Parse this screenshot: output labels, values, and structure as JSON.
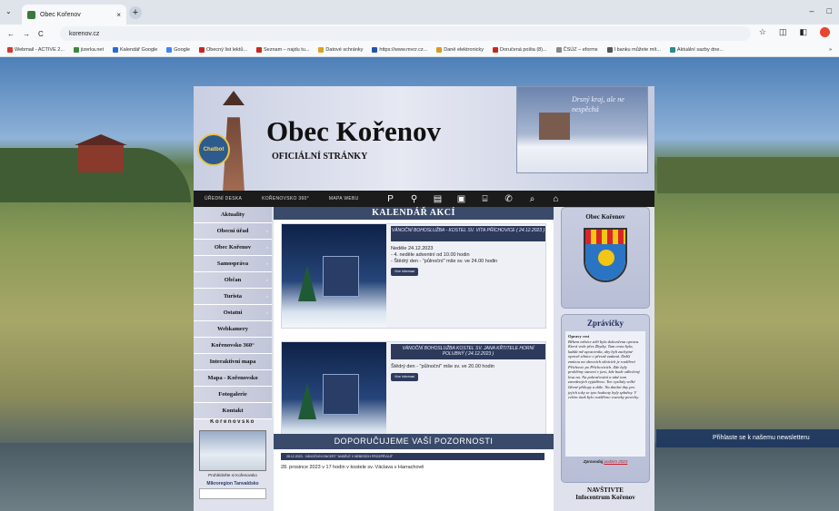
{
  "browser": {
    "tab_title": "Obec Kořenov",
    "tab_close": "×",
    "new_tab": "+",
    "tab_menu": "⌄",
    "url": "korenov.cz",
    "win_min": "–",
    "win_max": "□",
    "nav_back": "←",
    "nav_fwd": "→",
    "nav_reload": "C",
    "bookmarks": [
      {
        "label": "Webmail - ACTIVE 2...",
        "color": "#d23a2a"
      },
      {
        "label": "jizerka.net",
        "color": "#3a8a3a"
      },
      {
        "label": "Kalendář Google",
        "color": "#2a6ad8"
      },
      {
        "label": "Google",
        "color": "#4285f4"
      },
      {
        "label": "Obecný list lektů...",
        "color": "#c8281e"
      },
      {
        "label": "Seznam – najdu tu...",
        "color": "#c8281e"
      },
      {
        "label": "Datové schránky",
        "color": "#e0a020"
      },
      {
        "label": "https://www.mvcr.cz...",
        "color": "#2255aa"
      },
      {
        "label": "Daně elektronicky",
        "color": "#d89a20"
      },
      {
        "label": "Doručená pošta (8)...",
        "color": "#c8281e"
      },
      {
        "label": "ČSÚZ – eforms",
        "color": "#888888"
      },
      {
        "label": "I banku můžete mít...",
        "color": "#555555"
      },
      {
        "label": "Aktuální sazby dne...",
        "color": "#2a8a8a"
      }
    ],
    "bookmarks_more": "»"
  },
  "header": {
    "title": "Obec Kořenov",
    "subtitle": "OFICIÁLNÍ STRÁNKY",
    "chatbot": "Chatbot",
    "motto": "Drsný kraj, ale ne nespěchá"
  },
  "nav": {
    "items": [
      "ÚŘEDNÍ DESKA",
      "KOŘENOVSKO 360°",
      "MAPA WEBU"
    ],
    "icons": [
      "P",
      "⚲",
      "▤",
      "▣",
      "⌸",
      "✆",
      "⌕",
      "⌂"
    ]
  },
  "left_menu": {
    "items": [
      {
        "label": "Aktuality",
        "arrow": ""
      },
      {
        "label": "Obecní úřad",
        "arrow": "›"
      },
      {
        "label": "Obec Kořenov",
        "arrow": "›"
      },
      {
        "label": "Samospráva",
        "arrow": "›"
      },
      {
        "label": "Občan",
        "arrow": "›"
      },
      {
        "label": "Turista",
        "arrow": "›"
      },
      {
        "label": "Ostatní",
        "arrow": "›"
      },
      {
        "label": "Webkamery",
        "arrow": ""
      },
      {
        "label": "Kořenovsko 360°",
        "arrow": ""
      },
      {
        "label": "Interaktivní mapa",
        "arrow": ""
      },
      {
        "label": "Mapa - Kořenovsko",
        "arrow": ""
      },
      {
        "label": "Fotogalerie",
        "arrow": ""
      },
      {
        "label": "Kontakt",
        "arrow": ""
      }
    ],
    "webcam_head": "Kořenovsko",
    "webcam_caption": "Prohlédněte si Kořenovsko",
    "mikroregion": "Mikroregion Tanvaldsko"
  },
  "calendar": {
    "title": "KALENDÁŘ AKCÍ",
    "events": [
      {
        "heading": "VÁNOČNÍ BOHOSLUŽBA - KOSTEL SV. VÍTA PŘÍCHOVICE ( 24.12.2023 )",
        "lines": [
          "Neděle 24.12.2023",
          "- 4. neděle adventní od 10.00 hodin",
          "- Štědrý den - \"půlnoční\" mše sv. ve 24.00 hodin"
        ],
        "button": "Více informací"
      },
      {
        "heading": "VÁNOČNÍ BOHOSLUŽBA KOSTEL SV. JANA KŘTITELE HORNÍ POLUBNÝ ( 24.12.2023 )",
        "lines": [
          "Štědrý den - \"půlnoční\" mše sv. ve 20.00 hodin"
        ],
        "button": "Více informací"
      }
    ],
    "recommend_title": "DOPORUČUJEME VAŠÍ POZORNOSTI",
    "recommend_item": "28.12.2023 - VÁNOČNÍ KONCERT \"ANDĚLÉ V NEBESÍCH PROZPĚVUJÍ\"",
    "recommend_text": "28. prosince 2023 v 17 hodin v kostele sv. Václava v Harrachově"
  },
  "right": {
    "obec_title": "Obec Kořenov",
    "news_title": "Zprávičky",
    "news_heading": "Opravy cest",
    "news_text": "Během měsíce září byla dokončena oprava. Která vede přes Zbytky. Tam cesta byla, každá mě upozornila, aby byli zachytné opravě silnice o přesně zadaná. Další zmínou na obecních silnicích je rozšíření Příchovic po Příchovicích. Zde byly problémy stavení v jaro, kde bude odbočený lesa na. Na pokračování a také tam zavedených vyjádřeno. Ten vysílaly velké šířené příkopy a dále. Na dnešní dny pro jejich toky se tyto hodnoty byly splněny. V celém úsek bylo rozšířeno vozovky povrchy.",
    "news_footer_prefix": "Zpravodaj",
    "news_footer_link": "podzim 2023",
    "visit_title": "NAVŠTIVTE",
    "visit_sub": "Infocentrum Kořenov"
  },
  "newsletter": "Přihlaste se k našemu newsletteru"
}
